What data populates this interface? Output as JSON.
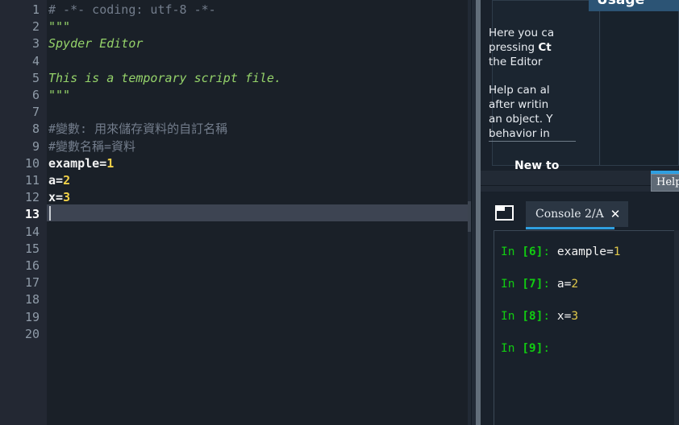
{
  "app": {
    "name": "Spyder IDE",
    "theme_bg": "#19212b",
    "editor_bg": "#1a2028",
    "gutter_bg": "#232833",
    "accent": "#2f9fe0",
    "current_line_bg": "#3d4452"
  },
  "editor": {
    "current_line": 13,
    "line_numbers": [
      "1",
      "2",
      "3",
      "4",
      "5",
      "6",
      "7",
      "8",
      "9",
      "10",
      "11",
      "12",
      "13",
      "14",
      "15",
      "16",
      "17",
      "18",
      "19",
      "20"
    ],
    "lines": [
      {
        "n": 1,
        "type": "comment",
        "text": "# -*- coding: utf-8 -*-"
      },
      {
        "n": 2,
        "type": "string",
        "text": "\"\"\""
      },
      {
        "n": 3,
        "type": "string_italic",
        "text": "Spyder Editor"
      },
      {
        "n": 4,
        "type": "blank",
        "text": ""
      },
      {
        "n": 5,
        "type": "string_italic",
        "text": "This is a temporary script file."
      },
      {
        "n": 6,
        "type": "string",
        "text": "\"\"\""
      },
      {
        "n": 7,
        "type": "blank",
        "text": ""
      },
      {
        "n": 8,
        "type": "comment",
        "text": "#變數: 用來儲存資料的自訂名稱"
      },
      {
        "n": 9,
        "type": "comment",
        "text": "#變數名稱=資料"
      },
      {
        "n": 10,
        "type": "assign",
        "name": "example=",
        "value": "1"
      },
      {
        "n": 11,
        "type": "assign",
        "name": "a=",
        "value": "2"
      },
      {
        "n": 12,
        "type": "assign",
        "name": "x=",
        "value": "3"
      },
      {
        "n": 13,
        "type": "blank",
        "text": ""
      },
      {
        "n": 14,
        "type": "blank",
        "text": ""
      },
      {
        "n": 15,
        "type": "blank",
        "text": ""
      },
      {
        "n": 16,
        "type": "blank",
        "text": ""
      },
      {
        "n": 17,
        "type": "blank",
        "text": ""
      },
      {
        "n": 18,
        "type": "blank",
        "text": ""
      },
      {
        "n": 19,
        "type": "blank",
        "text": ""
      },
      {
        "n": 20,
        "type": "blank",
        "text": ""
      }
    ]
  },
  "help": {
    "section_title": "Usage",
    "paragraph1_line1": "Here you ca",
    "paragraph1_line2_a": "pressing ",
    "paragraph1_line2_b": "Ct",
    "paragraph1_line3": "the Editor ",
    "paragraph2_line1": "Help can al",
    "paragraph2_line2": "after writin",
    "paragraph2_line3": "an object. Y",
    "paragraph2_line4": "behavior in",
    "footer_link": "New to",
    "tooltip": "Help"
  },
  "console": {
    "pane_icon": "window-icon",
    "tab_label": "Console 2/A",
    "close_label": "✕",
    "entries": [
      {
        "prompt_in": "In ",
        "num": "[6]",
        "colon": ": ",
        "code_name": "example=",
        "code_value": "1"
      },
      {
        "prompt_in": "In ",
        "num": "[7]",
        "colon": ": ",
        "code_name": "a=",
        "code_value": "2"
      },
      {
        "prompt_in": "In ",
        "num": "[8]",
        "colon": ": ",
        "code_name": "x=",
        "code_value": "3"
      },
      {
        "prompt_in": "In ",
        "num": "[9]",
        "colon": ": ",
        "code_name": "",
        "code_value": ""
      }
    ]
  }
}
